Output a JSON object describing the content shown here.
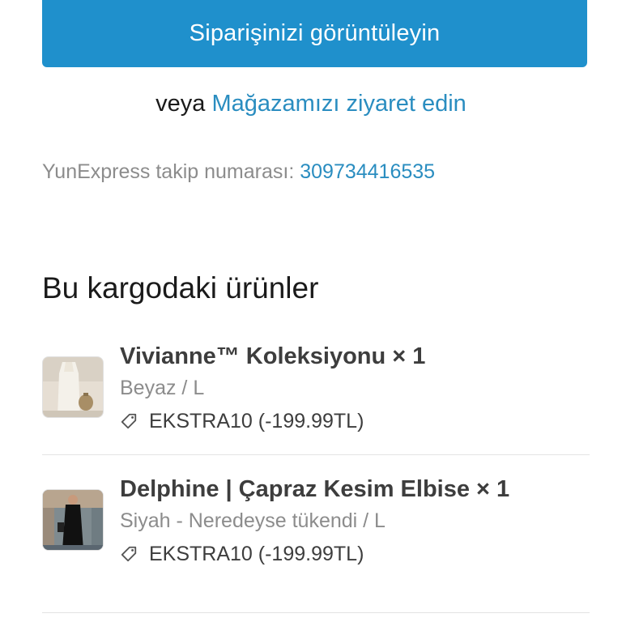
{
  "actions": {
    "view_order_label": "Siparişinizi görüntüleyin",
    "alt_prefix": "veya",
    "visit_store_label": "Mağazamızı ziyaret edin"
  },
  "tracking": {
    "label": "YunExpress takip numarası:",
    "number": "309734416535"
  },
  "section": {
    "title": "Bu kargodaki ürünler"
  },
  "items": [
    {
      "name": "Vivianne™ Koleksiyonu × 1",
      "variant": "Beyaz / L",
      "discount_code": "EKSTRA10 (-199.99TL)",
      "icon": "tag-icon"
    },
    {
      "name": "Delphine | Çapraz Kesim Elbise × 1",
      "variant": "Siyah - Neredeyse tükendi / L",
      "discount_code": "EKSTRA10 (-199.99TL)",
      "icon": "tag-icon"
    }
  ],
  "colors": {
    "primary": "#1f90cc",
    "link": "#2a8dc0",
    "muted_text": "#8c8c8c",
    "body_text": "#3d3d3d"
  }
}
